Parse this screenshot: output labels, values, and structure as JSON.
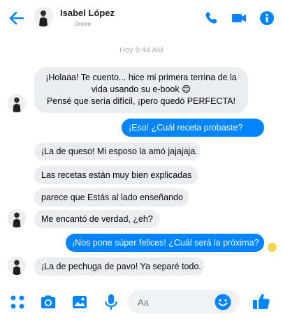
{
  "header": {
    "contact_name": "Isabel López",
    "status": "Online",
    "icons": [
      "back-arrow-icon",
      "phone-icon",
      "video-icon",
      "info-icon"
    ]
  },
  "timestamp": "Hoy 9:44 AM",
  "messages": [
    {
      "from": "contact",
      "lines": [
        "¡Holaaa! Te cuento... hice mi primera terrina de la",
        "vida usando su e-book 😊",
        "Pensé que sería difícil, ¡pero quedó PERFECTA!"
      ]
    },
    {
      "from": "me",
      "text": "¡Eso! ¿Cuál receta probaste?"
    },
    {
      "from": "contact",
      "text": "¡La de queso! Mi esposo la amó jajajaja."
    },
    {
      "from": "contact",
      "text": "Las recetas están muy bien explicadas"
    },
    {
      "from": "contact",
      "text": "parece que Estás al lado enseñando"
    },
    {
      "from": "contact",
      "text": "Me encantó de verdad, ¿eh?"
    },
    {
      "from": "me",
      "text": "¡Nos pone súper felices! ¿Cuál será la próxima?"
    },
    {
      "from": "contact",
      "text": "¡La de pechuga de pavo! Ya separé todo."
    }
  ],
  "composer": {
    "placeholder": "Aa",
    "icons": [
      "more-icon",
      "camera-icon",
      "photo-icon",
      "mic-icon",
      "emoji-icon",
      "like-icon"
    ]
  },
  "colors": {
    "accent": "#0084ff",
    "incoming_bubble": "#ebedf0",
    "seen_indicator": "#f7d64b"
  }
}
